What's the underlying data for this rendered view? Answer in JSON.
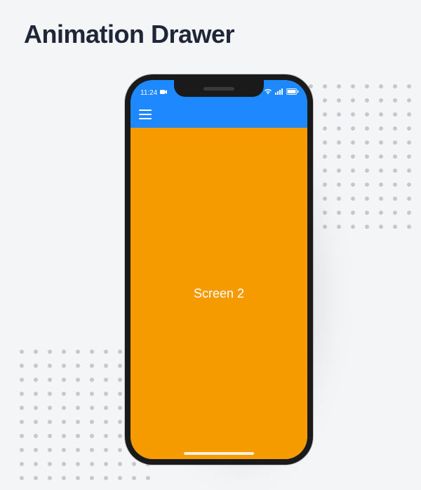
{
  "page": {
    "title": "Animation Drawer"
  },
  "status_bar": {
    "time": "11:24",
    "wifi": "wifi",
    "battery": "battery"
  },
  "app": {
    "menu_icon": "menu",
    "screen_label": "Screen 2",
    "colors": {
      "header": "#1e88ff",
      "content": "#f59b00"
    }
  }
}
